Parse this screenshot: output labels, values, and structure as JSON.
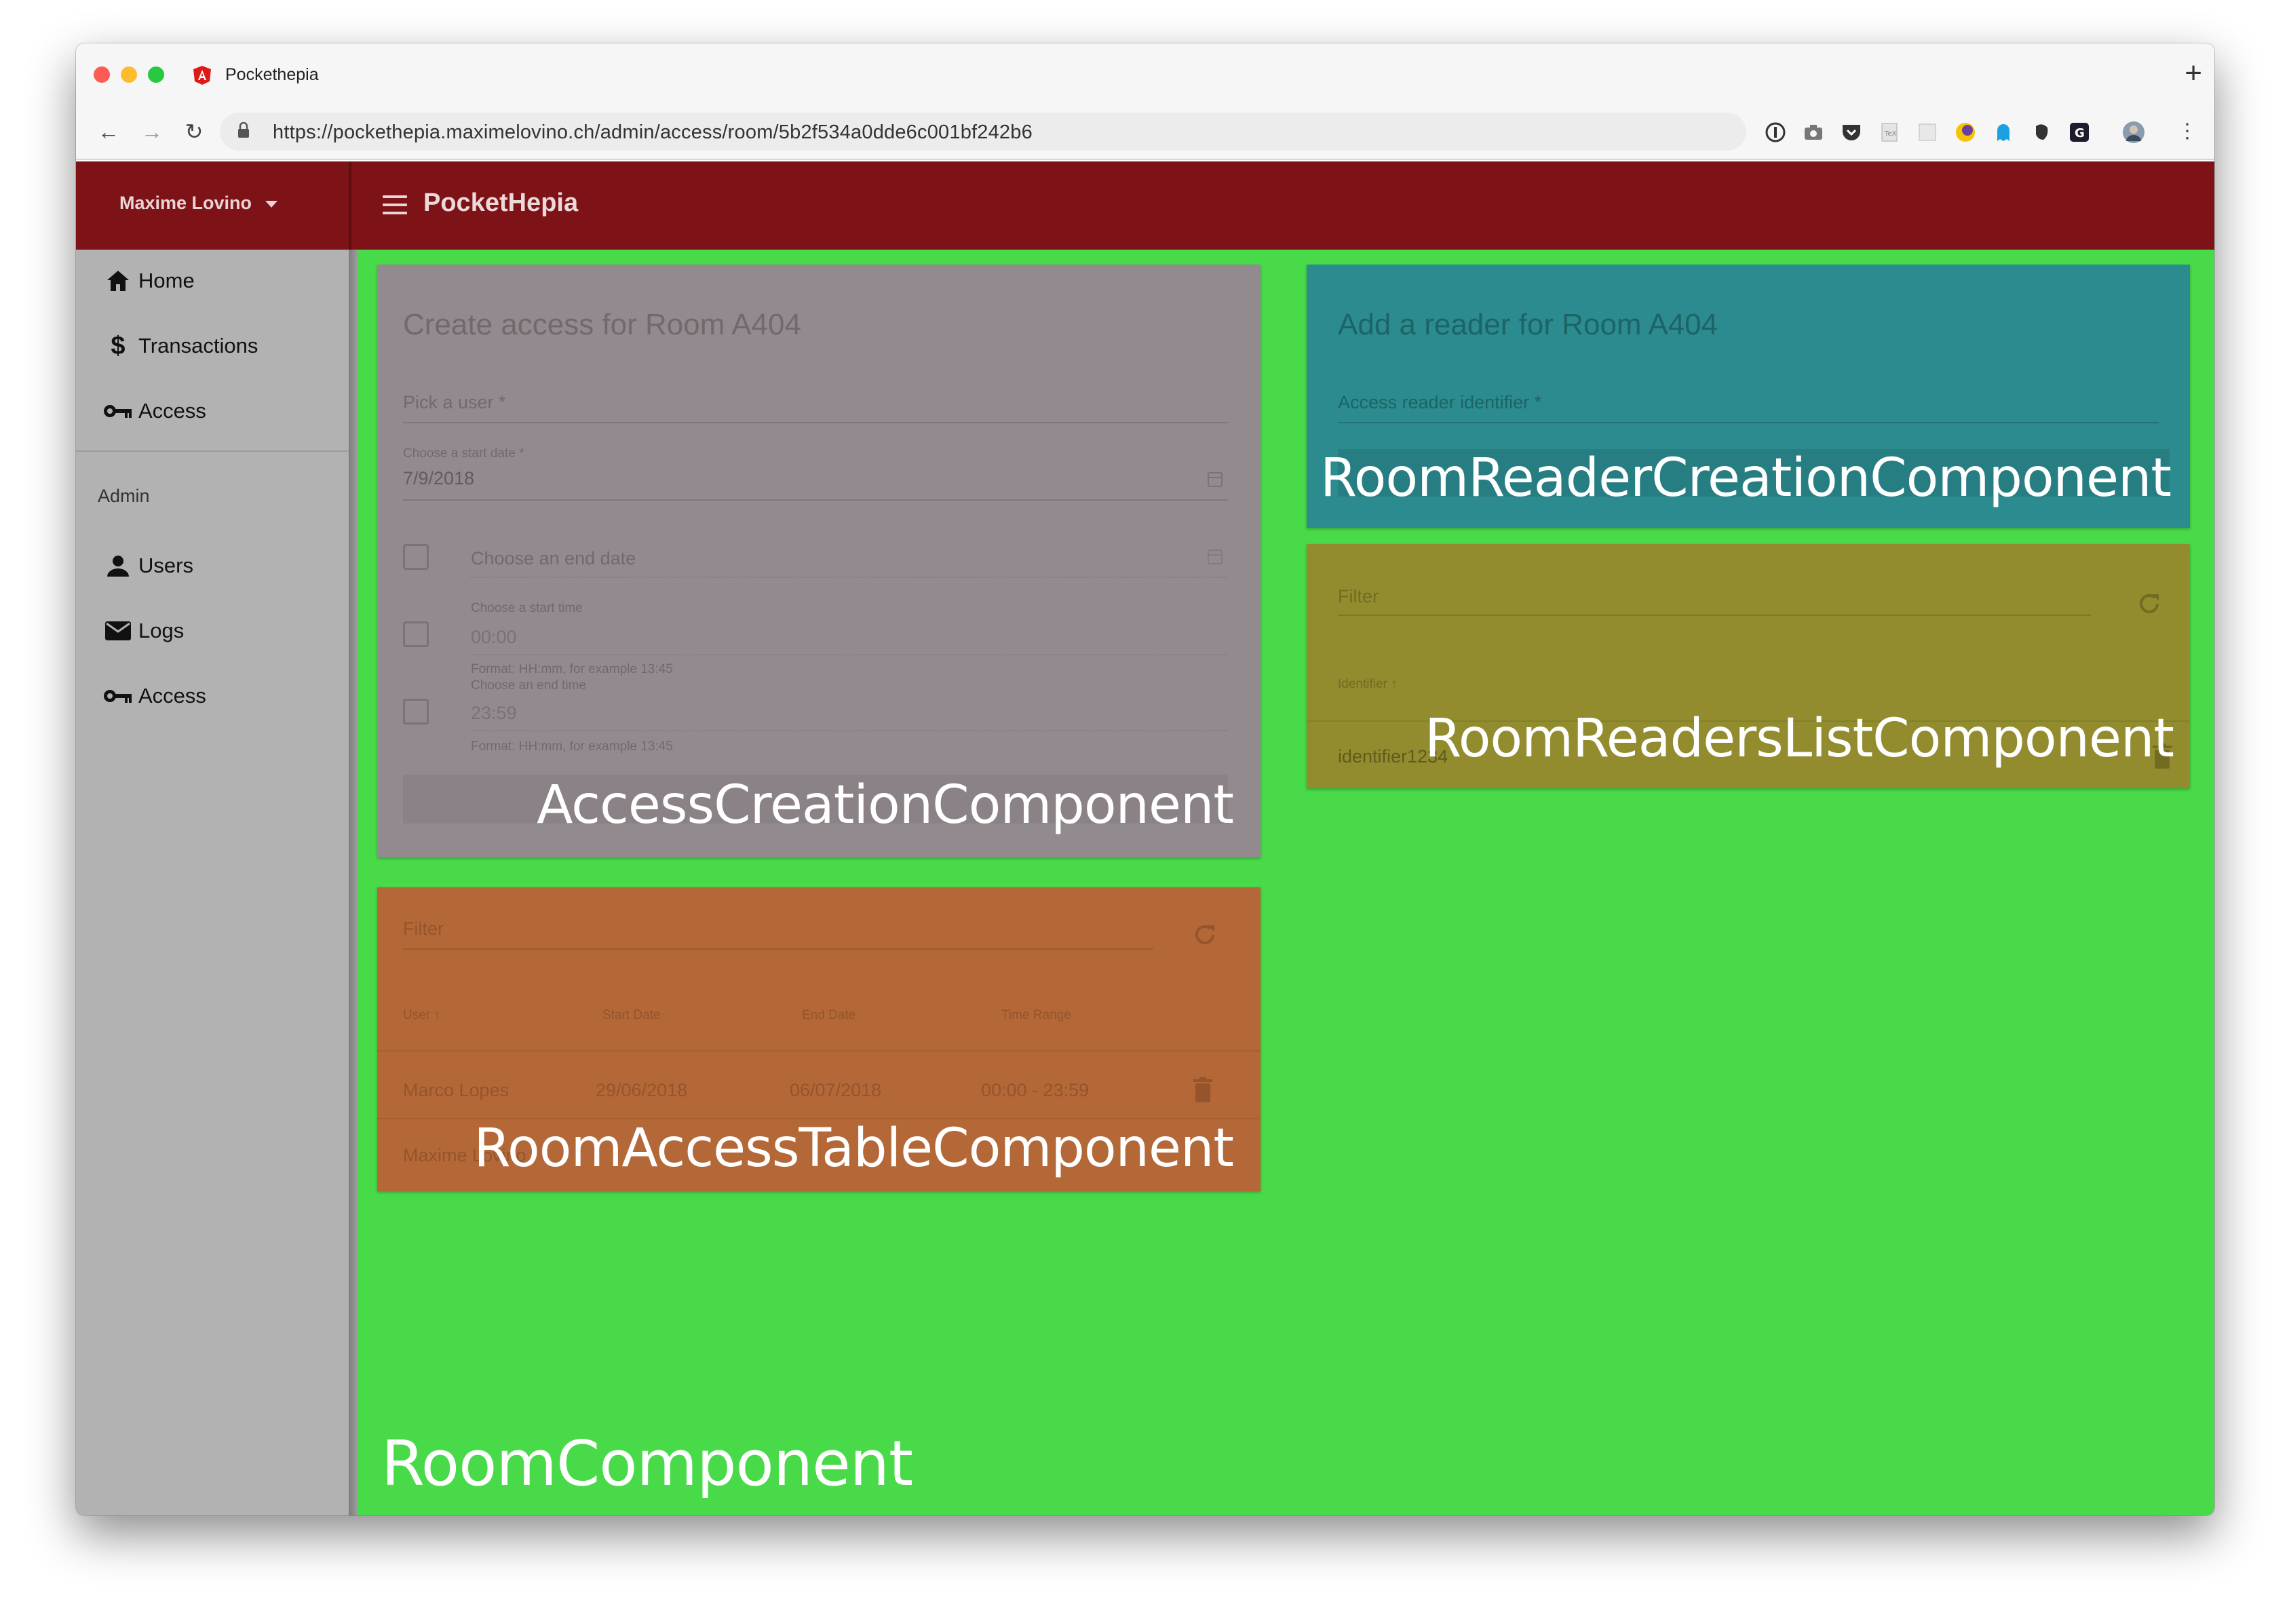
{
  "browser": {
    "tab_title": "Pockethepia",
    "url": "https://pockethepia.maximelovino.ch/admin/access/room/5b2f534a0dde6c001bf242b6",
    "new_tab_symbol": "+",
    "back_symbol": "←",
    "forward_symbol": "→",
    "reload_symbol": "↻",
    "menu_symbol": "⋮"
  },
  "header": {
    "user_name": "Maxime Lovino",
    "brand": "PocketHepia"
  },
  "sidebar": {
    "items": [
      {
        "label": "Home",
        "icon": "home-icon"
      },
      {
        "label": "Transactions",
        "icon": "dollar-icon"
      },
      {
        "label": "Access",
        "icon": "key-icon"
      }
    ],
    "admin_section_label": "Admin",
    "admin_items": [
      {
        "label": "Users",
        "icon": "person-icon"
      },
      {
        "label": "Logs",
        "icon": "mail-icon"
      },
      {
        "label": "Access",
        "icon": "key-icon"
      }
    ]
  },
  "access_creation": {
    "title": "Create access for Room A404",
    "user_placeholder": "Pick a user *",
    "start_date_label": "Choose a start date *",
    "start_date_value": "7/9/2018",
    "end_date_label": "Choose an end date",
    "start_time_label": "Choose a start time",
    "start_time_value": "00:00",
    "start_time_hint": "Format: HH:mm, for example 13:45",
    "end_time_label": "Choose an end time",
    "end_time_value": "23:59",
    "end_time_hint": "Format: HH:mm, for example 13:45",
    "overlay_label": "AccessCreationComponent"
  },
  "room_access_table": {
    "filter_placeholder": "Filter",
    "columns": [
      "User",
      "Start Date",
      "End Date",
      "Time Range"
    ],
    "rows": [
      {
        "user": "Marco Lopes",
        "start": "29/06/2018",
        "end": "06/07/2018",
        "range": "00:00 - 23:59"
      },
      {
        "user": "Maxime Lovino",
        "start": "",
        "end": "",
        "range": ""
      }
    ],
    "overlay_label": "RoomAccessTableComponent"
  },
  "reader_creation": {
    "title": "Add a reader for Room A404",
    "identifier_placeholder": "Access reader identifier *",
    "overlay_label": "RoomReaderCreationComponent"
  },
  "readers_list": {
    "filter_placeholder": "Filter",
    "column": "Identifier",
    "rows": [
      "identifier1234"
    ],
    "overlay_label": "RoomReadersListComponent"
  },
  "room_overlay_label": "RoomComponent",
  "colors": {
    "header": "#7d1316",
    "room_area": "#48da48",
    "creation_card": "#938a8f",
    "table_card": "#b46838",
    "reader_card": "#2b8b8f",
    "list_card": "#928c2f"
  }
}
